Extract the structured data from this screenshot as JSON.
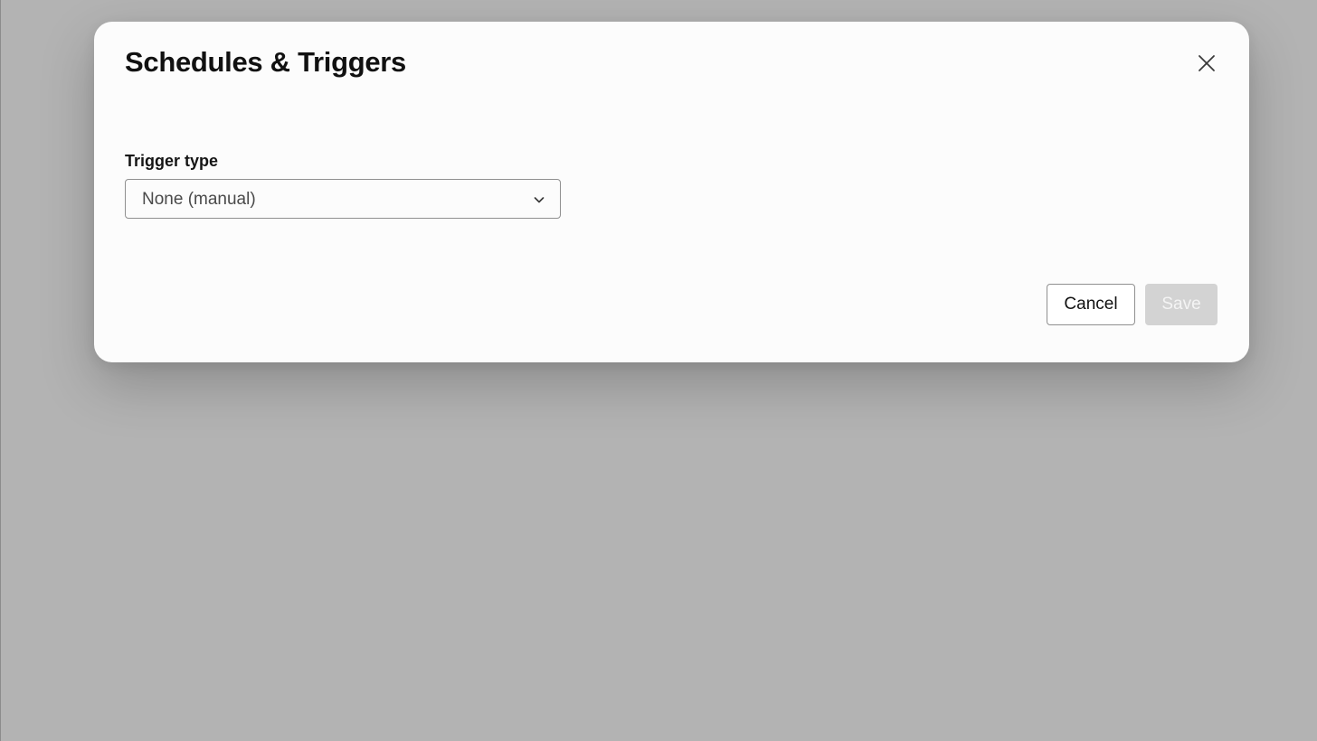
{
  "dialog": {
    "title": "Schedules & Triggers",
    "close_icon": "close-icon"
  },
  "trigger_type": {
    "label": "Trigger type",
    "selected_value": "None (manual)",
    "chevron_icon": "chevron-down-icon"
  },
  "footer": {
    "cancel_label": "Cancel",
    "save_label": "Save",
    "save_disabled": true
  },
  "colors": {
    "backdrop": "#b3b3b3",
    "dialog_background": "#fcfcfc",
    "save_disabled_background": "#d3d3d3"
  }
}
